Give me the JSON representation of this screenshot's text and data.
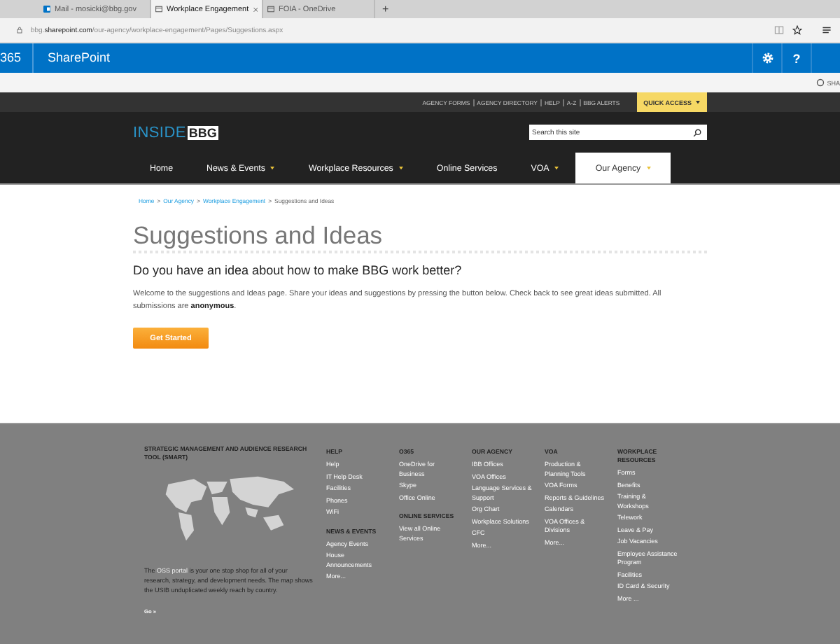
{
  "browser": {
    "tabs": [
      {
        "label": "Mail - mosicki@bbg.gov",
        "kind": "mail",
        "selected": false
      },
      {
        "label": "Workplace Engagement",
        "kind": "page",
        "selected": true
      },
      {
        "label": "FOIA - OneDrive",
        "kind": "page",
        "selected": false
      }
    ],
    "new_tab": "+",
    "url": "bbg.**sharepoint.com**/our-agency/workplace-engagement/Pages/Suggestions.aspx"
  },
  "suite_bar": {
    "launcher": "365",
    "title": "SharePoint",
    "help": "?"
  },
  "ribbon": {
    "share": "SHA"
  },
  "top_links": [
    "AGENCY FORMS",
    "AGENCY DIRECTORY",
    "HELP",
    "A-Z",
    "BBG ALERTS"
  ],
  "quick_access": "QUICK ACCESS",
  "logo": {
    "text": "INSIDE",
    "mark": "BBG"
  },
  "search": {
    "placeholder": "Search this site"
  },
  "nav": [
    {
      "label": "Home",
      "dropdown": false,
      "selected": false
    },
    {
      "label": "News & Events",
      "dropdown": true,
      "selected": false
    },
    {
      "label": "Workplace Resources",
      "dropdown": true,
      "selected": false
    },
    {
      "label": "Online Services",
      "dropdown": false,
      "selected": false
    },
    {
      "label": "VOA",
      "dropdown": true,
      "selected": false
    },
    {
      "label": "Our Agency",
      "dropdown": true,
      "selected": true
    }
  ],
  "breadcrumb": {
    "separator": ">",
    "items": [
      {
        "label": "Home",
        "link": true
      },
      {
        "label": "Our Agency",
        "link": true
      },
      {
        "label": "Workplace Engagement",
        "link": true
      },
      {
        "label": "Suggestions and Ideas",
        "link": false
      }
    ]
  },
  "title": "Suggestions and Ideas",
  "question": "Do you have an idea about how to make BBG work better?",
  "intro": "Welcome to the suggestions and Ideas page. Share your ideas and suggestions by pressing the button below. Check back to see great ideas submitted. All submissions are **anonymous**.",
  "button": "Get Started",
  "footer": {
    "smart": {
      "title": "STRATEGIC MANAGEMENT AND AUDIENCE RESEARCH TOOL (SMART)",
      "text": "The **OSS portal** is your one stop shop for all of your research, strategy, and development needs. The map shows the USIB unduplicated weekly reach by country.",
      "go": "Go »"
    },
    "columns": [
      [
        {
          "heading": "HELP",
          "links": [
            "Help",
            "IT Help Desk",
            "Facilities",
            "Phones",
            "WiFi"
          ]
        },
        {
          "heading": "NEWS & EVENTS",
          "links": [
            "Agency Events",
            "House Announcements",
            "More..."
          ]
        }
      ],
      [
        {
          "heading": "O365",
          "links": [
            "OneDrive for Business",
            "Skype",
            "Office Online"
          ]
        },
        {
          "heading": "ONLINE SERVICES",
          "links": [
            "View all Online Services"
          ]
        }
      ],
      [
        {
          "heading": "OUR AGENCY",
          "links": [
            "IBB Offices",
            "VOA Offices",
            "Language Services & Support",
            "Org Chart",
            "Workplace Solutions",
            "CFC",
            "More..."
          ]
        }
      ],
      [
        {
          "heading": "VOA",
          "links": [
            "Production & Planning Tools",
            "VOA Forms",
            "Reports & Guidelines",
            "Calendars",
            "VOA Offices & Divisions",
            "More..."
          ]
        }
      ],
      [
        {
          "heading": "WORKPLACE RESOURCES",
          "links": [
            "Forms",
            "Benefits",
            "Training & Workshops",
            "Telework",
            "Leave & Pay",
            "Job Vacancies",
            "Employee Assistance Program",
            "Facilities",
            "ID Card & Security",
            "More ..."
          ]
        }
      ]
    ]
  }
}
